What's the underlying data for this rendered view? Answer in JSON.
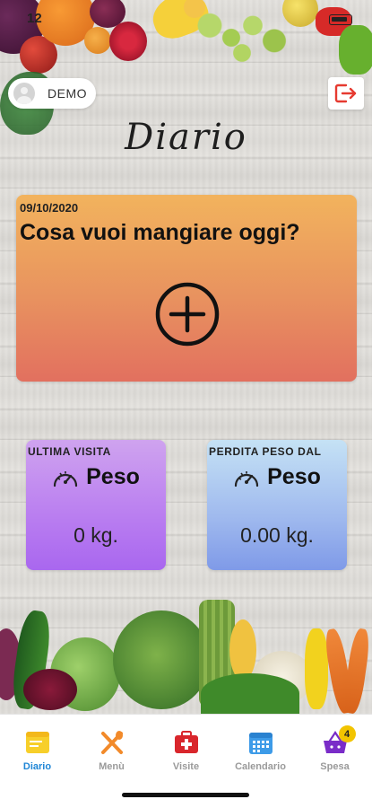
{
  "status_bar": {
    "time": "12",
    "battery_icon": "battery-icon"
  },
  "user": {
    "name": "DEMO"
  },
  "header": {
    "title": "Diario",
    "logout_icon": "logout-icon"
  },
  "main_card": {
    "date": "09/10/2020",
    "question": "Cosa vuoi mangiare oggi?",
    "add_icon": "plus-circle-icon"
  },
  "stats": [
    {
      "label": "ULTIMA VISITA",
      "title": "Peso",
      "value": "0 kg.",
      "icon": "gauge-icon"
    },
    {
      "label": "PERDITA PESO DAL",
      "title": "Peso",
      "value": "0.00 kg.",
      "icon": "gauge-icon"
    }
  ],
  "tabs": [
    {
      "label": "Diario",
      "icon": "diary-icon",
      "active": true
    },
    {
      "label": "Menù",
      "icon": "utensils-icon",
      "active": false
    },
    {
      "label": "Visite",
      "icon": "medical-kit-icon",
      "active": false
    },
    {
      "label": "Calendario",
      "icon": "calendar-icon",
      "active": false
    },
    {
      "label": "Spesa",
      "icon": "shopping-basket-icon",
      "active": false,
      "badge": "4"
    }
  ],
  "colors": {
    "accent": "#1f86d6",
    "card_warm_top": "#f2b35d",
    "card_warm_bottom": "#e2705f",
    "card_purple": "#b97df0",
    "card_blue": "#9fb9ee",
    "badge": "#f2c400"
  }
}
